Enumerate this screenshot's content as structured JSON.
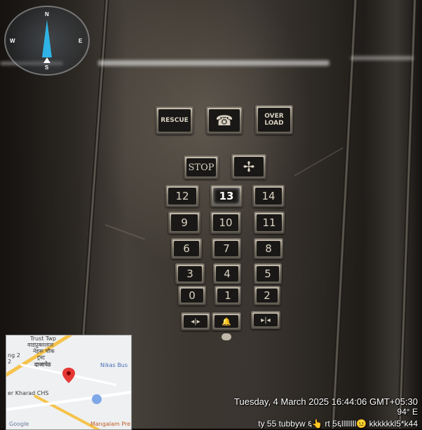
{
  "panel": {
    "top_buttons": [
      {
        "id": "rescue",
        "label": "RESCUE"
      },
      {
        "id": "phone",
        "label": "☎"
      },
      {
        "id": "overload",
        "label": "OVER LOAD"
      }
    ],
    "stop_label": "STOP",
    "fan_label": "✢",
    "floors": [
      {
        "label": "12"
      },
      {
        "label": "13",
        "active": true
      },
      {
        "label": "14"
      },
      {
        "label": "9"
      },
      {
        "label": "10"
      },
      {
        "label": "11"
      },
      {
        "label": "6"
      },
      {
        "label": "7"
      },
      {
        "label": "8"
      },
      {
        "label": "3"
      },
      {
        "label": "4"
      },
      {
        "label": "5"
      },
      {
        "label": "0"
      },
      {
        "label": "1"
      },
      {
        "label": "2"
      }
    ],
    "door_buttons": [
      {
        "id": "door-open",
        "label": "◂|▸"
      },
      {
        "id": "alarm",
        "label": "🔔"
      },
      {
        "id": "door-close",
        "label": "▸|◂"
      }
    ]
  },
  "compass": {
    "n": "N",
    "e": "E",
    "s": "S",
    "w": "W"
  },
  "map": {
    "labels": [
      {
        "text": "Trust Twp"
      },
      {
        "text": "वाडप्रुक्तलाल"
      },
      {
        "text": "नेहरू चौक"
      },
      {
        "text": "ट्रस्ट"
      },
      {
        "text": "दाजापेठ"
      },
      {
        "text": "Nikas Bus"
      },
      {
        "text": "Mangalam Pre"
      },
      {
        "text": "er Kharad CHS"
      },
      {
        "text": "Google"
      },
      {
        "text": "ng 2"
      },
      {
        "text": "2"
      }
    ]
  },
  "stamp": {
    "line1": "Tuesday, 4 March 2025 16:44:06 GMT+05:30",
    "line2": "94° E",
    "line3": "ty 55 tubbyw ६👆 rt 5६llllllll😐 kkkkkkl5*k44"
  }
}
